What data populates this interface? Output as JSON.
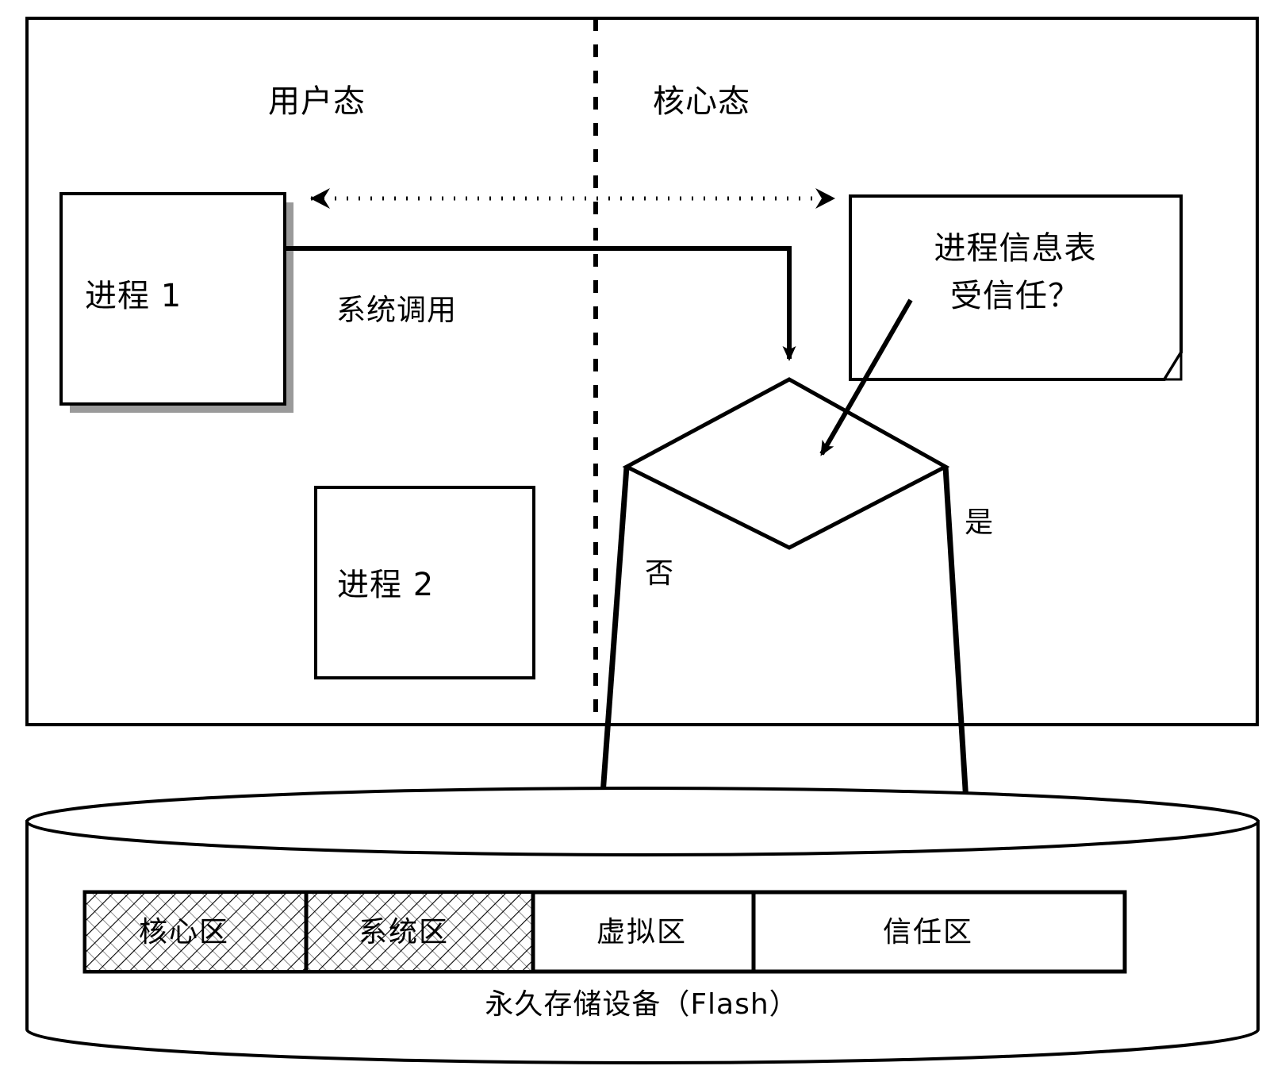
{
  "diagram": {
    "title_hidden": "",
    "mode_labels": {
      "user_mode": "用户态",
      "kernel_mode": "核心态"
    },
    "nodes": {
      "process1": "进程 1",
      "process2": "进程 2",
      "syscall": "系统调用",
      "note": {
        "line1": "进程信息表",
        "line2": "受信任？"
      },
      "decision": ""
    },
    "branch_labels": {
      "no": "否",
      "yes": "是"
    },
    "storage": {
      "caption": "永久存储设备（Flash）",
      "partitions": [
        {
          "label": "核心区",
          "fill": "hatched"
        },
        {
          "label": "系统区",
          "fill": "hatched"
        },
        {
          "label": "虚拟区",
          "fill": "plain"
        },
        {
          "label": "信任区",
          "fill": "plain"
        }
      ]
    },
    "colors": {
      "stroke": "#000000",
      "background": "#ffffff",
      "shadow": "#9a9a9a",
      "hatch": "#000000"
    },
    "icons": {
      "decision": "diamond-icon",
      "note": "note-document-icon",
      "storage": "cylinder-database-icon",
      "divider": "dashed-vertical-divider-icon",
      "syscall_arrow": "solid-arrow-icon",
      "ipc_arrow": "dotted-double-arrow-icon"
    }
  }
}
